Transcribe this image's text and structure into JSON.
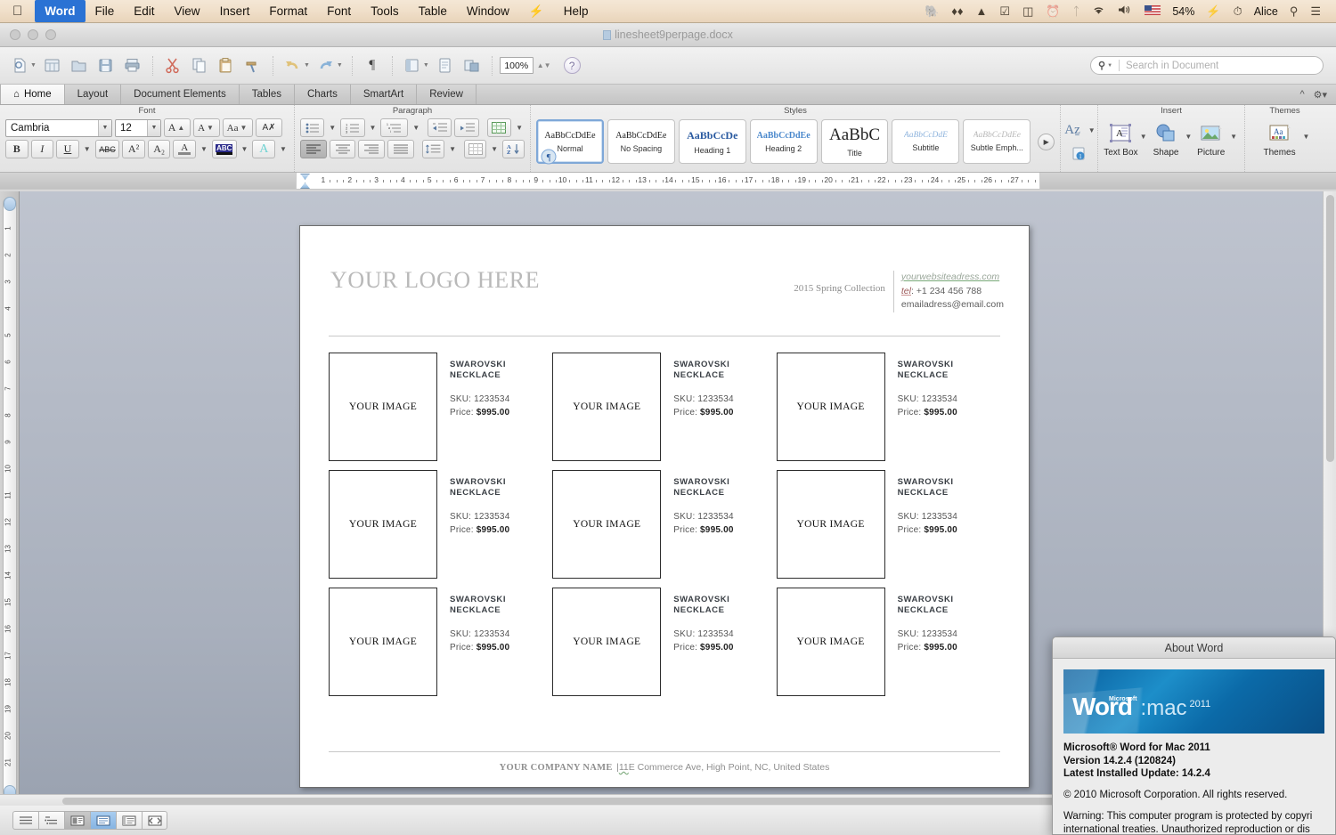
{
  "menubar": {
    "apple": "apple-logo",
    "items": [
      {
        "label": "Word",
        "active": true
      },
      {
        "label": "File",
        "active": false
      },
      {
        "label": "Edit",
        "active": false
      },
      {
        "label": "View",
        "active": false
      },
      {
        "label": "Insert",
        "active": false
      },
      {
        "label": "Format",
        "active": false
      },
      {
        "label": "Font",
        "active": false
      },
      {
        "label": "Tools",
        "active": false
      },
      {
        "label": "Table",
        "active": false
      },
      {
        "label": "Window",
        "active": false
      },
      {
        "label": "⚡",
        "active": false
      },
      {
        "label": "Help",
        "active": false
      }
    ],
    "status": {
      "battery": "54%",
      "user": "Alice",
      "flag": "us-flag-icon",
      "icons": [
        "elephant-icon",
        "dropbox-icon",
        "app-icon",
        "checkmark-icon",
        "airplay-icon",
        "timemachine-icon",
        "bluetooth-icon",
        "wifi-icon",
        "volume-icon"
      ]
    }
  },
  "window": {
    "title": "linesheet9perpage.docx"
  },
  "toolbar": {
    "zoom_value": "100%",
    "buttons": [
      "new-document",
      "open-gallery",
      "open-file",
      "save",
      "print",
      "cut",
      "copy",
      "paste",
      "format-painter",
      "undo",
      "redo",
      "show-marks",
      "columns",
      "document-view",
      "table",
      "zoom",
      "help"
    ],
    "search_placeholder": "Search in Document"
  },
  "ribbon": {
    "tabs": [
      {
        "label": "Home",
        "active": true,
        "icon": "home-icon"
      },
      {
        "label": "Layout",
        "active": false
      },
      {
        "label": "Document Elements",
        "active": false
      },
      {
        "label": "Tables",
        "active": false
      },
      {
        "label": "Charts",
        "active": false
      },
      {
        "label": "SmartArt",
        "active": false
      },
      {
        "label": "Review",
        "active": false
      }
    ],
    "groups": {
      "font": {
        "title": "Font",
        "family": "Cambria",
        "size": "12",
        "buttons": [
          "grow-font",
          "shrink-font",
          "change-case",
          "clear-formatting",
          "bold",
          "italic",
          "underline",
          "strikethrough",
          "superscript",
          "subscript",
          "font-color",
          "highlight",
          "text-effects"
        ]
      },
      "paragraph": {
        "title": "Paragraph",
        "buttons": [
          "bullets",
          "numbering",
          "multilevel-list",
          "decrease-indent",
          "increase-indent",
          "borders",
          "align-left",
          "align-center",
          "align-right",
          "justify",
          "line-spacing",
          "shading",
          "sort"
        ]
      },
      "styles": {
        "title": "Styles",
        "items": [
          {
            "name": "Normal",
            "sample": "AaBbCcDdEе",
            "selected": true
          },
          {
            "name": "No Spacing",
            "sample": "AaBbCcDdEе",
            "selected": false
          },
          {
            "name": "Heading 1",
            "sample": "AaBbCcDе",
            "selected": false
          },
          {
            "name": "Heading 2",
            "sample": "AaBbCcDdEе",
            "selected": false
          },
          {
            "name": "Title",
            "sample": "AaBbC",
            "selected": false
          },
          {
            "name": "Subtitle",
            "sample": "AaBbCcDdE",
            "selected": false
          },
          {
            "name": "Subtle Emph...",
            "sample": "AaBbCcDdEe",
            "selected": false
          }
        ]
      },
      "insert": {
        "title": "Insert",
        "items": [
          {
            "label": "Text Box",
            "icon": "textbox-icon"
          },
          {
            "label": "Shape",
            "icon": "shape-icon"
          },
          {
            "label": "Picture",
            "icon": "picture-icon"
          }
        ]
      },
      "themes": {
        "title": "Themes",
        "items": [
          {
            "label": "Themes",
            "icon": "themes-icon"
          }
        ]
      }
    }
  },
  "ruler": {
    "h_numbers": [
      "1",
      "2",
      "3",
      "4",
      "5",
      "6",
      "7",
      "8",
      "9",
      "10",
      "11",
      "12",
      "13",
      "14",
      "15",
      "16",
      "17",
      "18",
      "19",
      "20",
      "21",
      "22",
      "23",
      "24",
      "25",
      "26",
      "27"
    ],
    "v_numbers": [
      "1",
      "2",
      "3",
      "4",
      "5",
      "6",
      "7",
      "8",
      "9",
      "10",
      "11",
      "12",
      "13",
      "14",
      "15",
      "16",
      "17",
      "18",
      "19",
      "20",
      "21"
    ]
  },
  "document": {
    "logo": "YOUR LOGO HERE",
    "collection": "2015 Spring Collection",
    "contact": {
      "website": "yourwebsiteadress.com",
      "tel_label": "tel",
      "tel": ": +1 234 456 788",
      "email": "emailadress@email.com"
    },
    "image_placeholder": "YOUR IMAGE",
    "products": [
      {
        "name": "SWAROVSKI NECKLACE",
        "sku_label": "SKU:",
        "sku": "1233534",
        "price_label": "Price:",
        "price": "$995.00"
      },
      {
        "name": "SWAROVSKI NECKLACE",
        "sku_label": "SKU:",
        "sku": "1233534",
        "price_label": "Price:",
        "price": "$995.00"
      },
      {
        "name": "SWAROVSKI NECKLACE",
        "sku_label": "SKU:",
        "sku": "1233534",
        "price_label": "Price:",
        "price": "$995.00"
      },
      {
        "name": "SWAROVSKI NECKLACE",
        "sku_label": "SKU:",
        "sku": "1233534",
        "price_label": "Price:",
        "price": "$995.00"
      },
      {
        "name": "SWAROVSKI NECKLACE",
        "sku_label": "SKU:",
        "sku": "1233534",
        "price_label": "Price:",
        "price": "$995.00"
      },
      {
        "name": "SWAROVSKI NECKLACE",
        "sku_label": "SKU:",
        "sku": "1233534",
        "price_label": "Price:",
        "price": "$995.00"
      },
      {
        "name": "SWAROVSKI NECKLACE",
        "sku_label": "SKU:",
        "sku": "1233534",
        "price_label": "Price:",
        "price": "$995.00"
      },
      {
        "name": "SWAROVSKI NECKLACE",
        "sku_label": "SKU:",
        "sku": "1233534",
        "price_label": "Price:",
        "price": "$995.00"
      },
      {
        "name": "SWAROVSKI NECKLACE",
        "sku_label": "SKU:",
        "sku": "1233534",
        "price_label": "Price:",
        "price": "$995.00"
      }
    ],
    "footer": {
      "company": "YOUR COMPANY NAME",
      "separator": "|",
      "street_no": "11",
      "address": "E Commerce Ave, High Point, NC, United States"
    }
  },
  "statusbar": {
    "views": [
      "draft-view",
      "outline-view",
      "publishing-view",
      "print-view",
      "notebook-view",
      "focus-view"
    ]
  },
  "about_dialog": {
    "title": "About Word",
    "splash": {
      "word": "Word",
      "ms": "Microsoft",
      "mac": ":mac",
      "year": "2011"
    },
    "product": "Microsoft® Word for Mac 2011",
    "version": "Version 14.2.4 (120824)",
    "update": "Latest Installed Update: 14.2.4",
    "copyright": "© 2010 Microsoft Corporation. All rights reserved.",
    "warning_line1": "Warning: This computer program is protected by copyri",
    "warning_line2": "international treaties.  Unauthorized reproduction or dis"
  },
  "colors": {
    "menu_accent": "#2a72d4",
    "splash_blue": "#1d8ec9",
    "selection_blue": "#7fa8d8"
  }
}
